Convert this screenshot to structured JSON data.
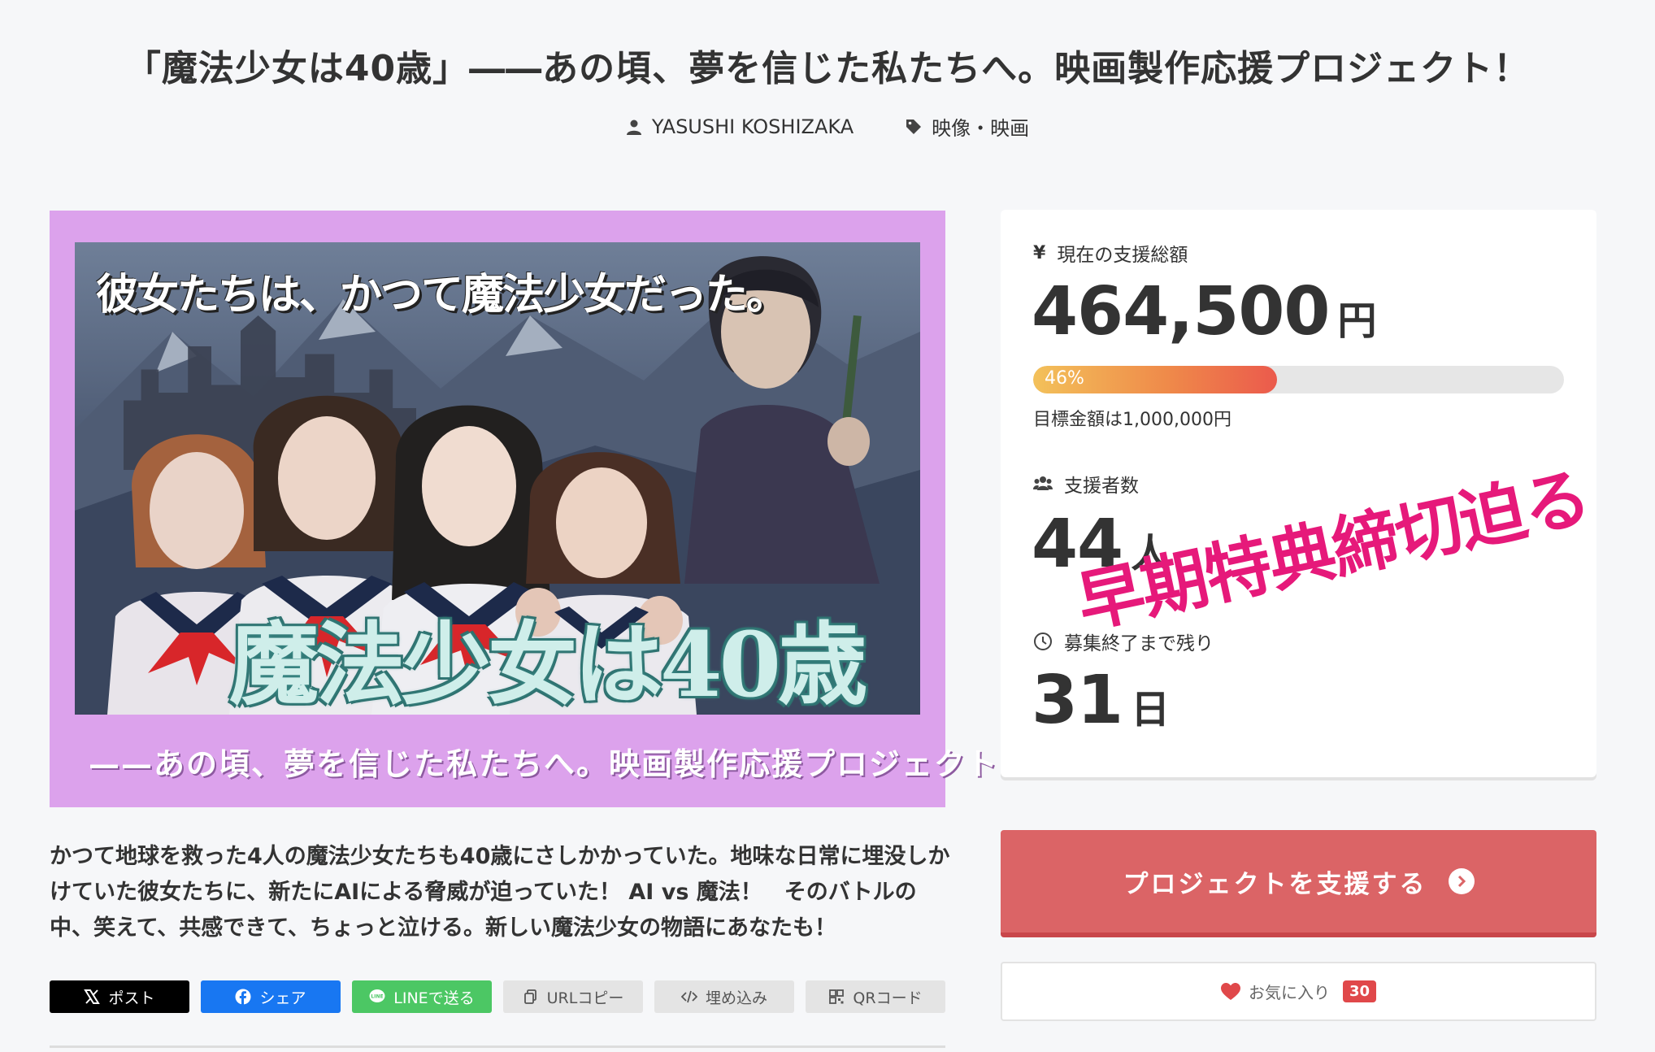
{
  "header": {
    "title": "「魔法少女は40歳」――あの頃、夢を信じた私たちへ。映画製作応援プロジェクト！",
    "author": "YASUSHI KOSHIZAKA",
    "category": "映像・映画"
  },
  "hero": {
    "tagline_top": "彼女たちは、かつて魔法少女だった。",
    "logo_text": "魔法少女は40歳",
    "subtitle": "——あの頃、夢を信じた私たちへ。映画製作応援プロジェクト！"
  },
  "description": "かつて地球を救った4人の魔法少女たちも40歳にさしかかっていた。地味な日常に埋没しかけていた彼女たちに、新たにAIによる脅威が迫っていた！ AI vs 魔法！　そのバトルの中、笑えて、共感できて、ちょっと泣ける。新しい魔法少女の物語にあなたも！",
  "share": {
    "x": "ポスト",
    "facebook": "シェア",
    "line": "LINEで送る",
    "url_copy": "URLコピー",
    "embed": "埋め込み",
    "qr": "QRコード"
  },
  "stats": {
    "total_label": "現在の支援総額",
    "total_value": "464,500",
    "total_unit": "円",
    "progress_percent": 46,
    "progress_label": "46%",
    "goal_text": "目標金額は1,000,000円",
    "backers_label": "支援者数",
    "backers_value": "44",
    "backers_unit": "人",
    "remaining_label": "募集終了まで残り",
    "remaining_value": "31",
    "remaining_unit": "日",
    "stamp_text": "早期特典締切迫る"
  },
  "actions": {
    "support_label": "プロジェクトを支援する",
    "favorite_label": "お気に入り",
    "favorite_count": "30"
  },
  "colors": {
    "support_button": "#db6466",
    "stamp": "#e6197a",
    "hero_frame": "#dca2ec"
  }
}
